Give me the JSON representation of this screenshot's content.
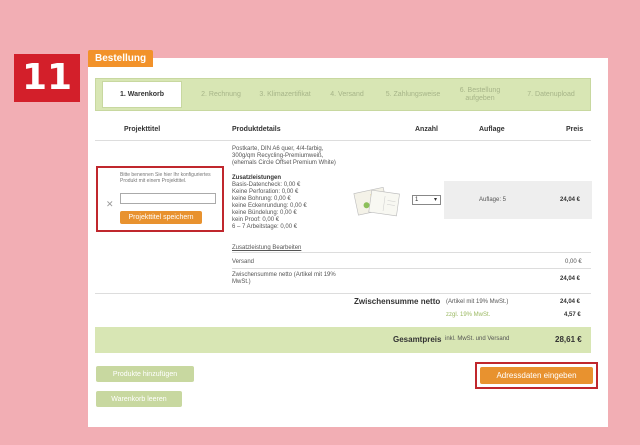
{
  "step_number": "11",
  "tab_label": "Bestellung",
  "steps": [
    {
      "label": "1. Warenkorb"
    },
    {
      "label": "2. Rechnung"
    },
    {
      "label": "3. Klimazertifikat"
    },
    {
      "label": "4. Versand"
    },
    {
      "label": "5. Zahlungsweise"
    },
    {
      "label": "6. Bestellung aufgeben"
    },
    {
      "label": "7. Datenupload"
    }
  ],
  "table_headers": {
    "project": "Projekttitel",
    "details": "Produktdetails",
    "quantity": "Anzahl",
    "edition": "Auflage",
    "price": "Preis"
  },
  "project": {
    "hint": "Bitte benennen Sie hier Ihr konfiguriertes Produkt mit einem Projekttitel.",
    "input_value": "",
    "save_label": "Projekttitel speichern",
    "remove_symbol": "✕"
  },
  "product": {
    "title": "Postkarte",
    "desc": ", DIN A6 quer, 4/4-farbig, 300g/qm Recycling-Premiumweiß, (ehemals Circle Offset Premium White)",
    "extras_heading": "Zusatzleistungen",
    "extras": [
      "Basis-Datencheck: 0,00 €",
      "Keine Perforation: 0,00 €",
      "keine Bohrung: 0,00 €",
      "keine Eckenrundung: 0,00 €",
      "keine Bündelung: 0,00 €",
      "kein Proof: 0,00 €",
      "6 – 7 Arbeitstage: 0,00 €"
    ],
    "edit_extras_link": "Zusatzleistung Bearbeiten",
    "quantity": "1",
    "edition": "Auflage: 5",
    "price": "24,04 €"
  },
  "shipping": {
    "label": "Versand",
    "value": "0,00 €"
  },
  "subtotal_line": {
    "label": "Zwischensumme netto (Artikel mit 19% MwSt.)",
    "value": "24,04 €"
  },
  "subtotal": {
    "label": "Zwischensumme netto",
    "note": "(Artikel mit 19% MwSt.)",
    "value": "24,04 €",
    "vat_label": "zzgl. 19% MwSt.",
    "vat_value": "4,57 €"
  },
  "total": {
    "label": "Gesamtpreis",
    "note": "inkl. MwSt. und Versand",
    "value": "28,61 €"
  },
  "buttons": {
    "add_products": "Produkte hinzufügen",
    "empty_cart": "Warenkorb leeren",
    "address": "Adressdaten eingeben"
  },
  "colors": {
    "accent_orange": "#e8922f",
    "highlight_red": "#c0272d",
    "green_bar": "#d8e6b4",
    "background_pink": "#f2aeb4"
  }
}
